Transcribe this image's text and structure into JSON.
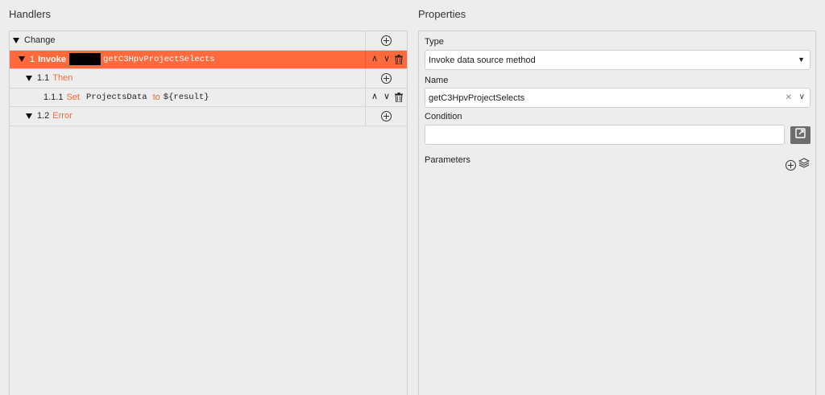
{
  "handlers": {
    "title": "Handlers",
    "rows": [
      {
        "label": "Change"
      },
      {
        "num": "1",
        "keyword": "Invoke",
        "method": "getC3HpvProjectSelects"
      },
      {
        "num": "1.1",
        "keyword": "Then"
      },
      {
        "num": "1.1.1",
        "keyword": "Set",
        "variable": "ProjectsData",
        "to_keyword": "to",
        "value": "${result}"
      },
      {
        "num": "1.2",
        "keyword": "Error"
      }
    ]
  },
  "properties": {
    "title": "Properties",
    "type_label": "Type",
    "type_value": "Invoke data source method",
    "name_label": "Name",
    "name_value": "getC3HpvProjectSelects",
    "condition_label": "Condition",
    "condition_value": "",
    "parameters_label": "Parameters"
  },
  "colors": {
    "accent": "#ff6a3d",
    "keyword": "#f26b3a"
  }
}
